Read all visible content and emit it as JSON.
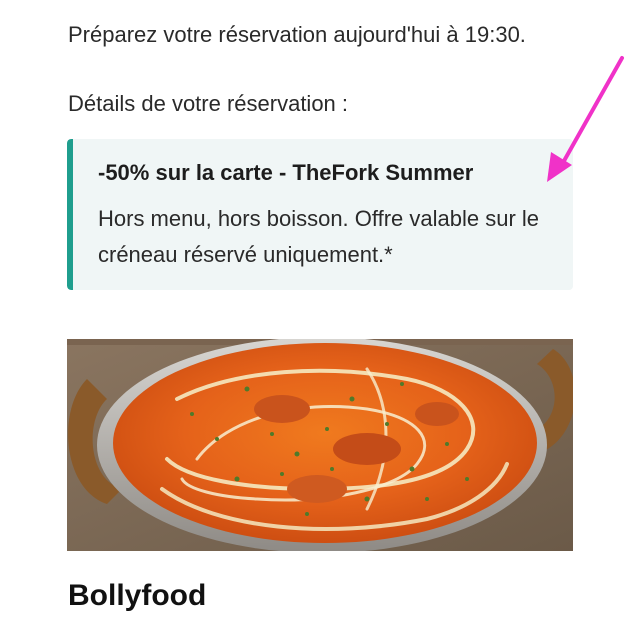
{
  "reservation": {
    "intro_text": "Préparez votre réservation aujourd'hui à 19:30.",
    "details_heading": "Détails de votre réservation :"
  },
  "offer": {
    "title": "-50% sur la carte - TheFork Summer",
    "description": "Hors menu, hors boisson. Offre valable sur le créneau réservé uniquement.*",
    "accent_color": "#1f9e8e",
    "background_color": "#f0f6f6"
  },
  "annotation": {
    "arrow_color": "#f032c8"
  },
  "restaurant": {
    "name": "Bollyfood"
  }
}
